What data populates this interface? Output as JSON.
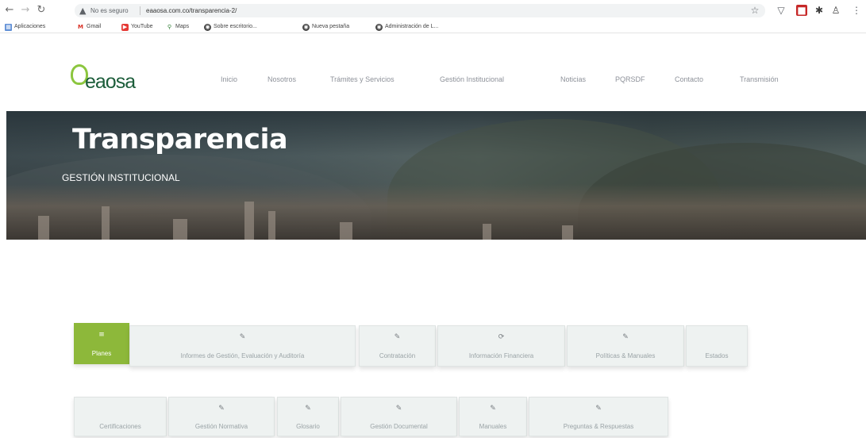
{
  "browser": {
    "security_label": "No es seguro",
    "url": "eaaosa.com.co/transparencia-2/",
    "bookmarks": [
      "Aplicaciones",
      "Gmail",
      "YouTube",
      "Maps",
      "Sobre escritorio...",
      "Nueva pestaña",
      "Administración de L..."
    ]
  },
  "site": {
    "logo_text": "eaosa",
    "menu": [
      "Inicio",
      "Nosotros",
      "Trámites y Servicios",
      "Gestión Institucional",
      "Noticias",
      "PQRSDF",
      "Contacto",
      "Transmisión"
    ]
  },
  "hero": {
    "title": "Transparencia",
    "subtitle": "GESTIÓN INSTITUCIONAL"
  },
  "tabs_row1": [
    {
      "label": "Planes",
      "icon": "≡"
    },
    {
      "label": "Informes de Gestión, Evaluación y Auditoría",
      "icon": "✎"
    },
    {
      "label": "Contratación",
      "icon": "✎"
    },
    {
      "label": "Información Financiera",
      "icon": "⟳"
    },
    {
      "label": "Políticas & Manuales",
      "icon": "✎"
    },
    {
      "label": "Estados",
      "icon": ""
    }
  ],
  "tabs_row2": [
    {
      "label": "Certificaciones",
      "icon": ""
    },
    {
      "label": "Gestión Normativa",
      "icon": "✎"
    },
    {
      "label": "Glosario",
      "icon": "✎"
    },
    {
      "label": "Gestión Documental",
      "icon": "✎"
    },
    {
      "label": "Manuales",
      "icon": "✎"
    },
    {
      "label": "Preguntas & Respuestas",
      "icon": "✎"
    }
  ]
}
